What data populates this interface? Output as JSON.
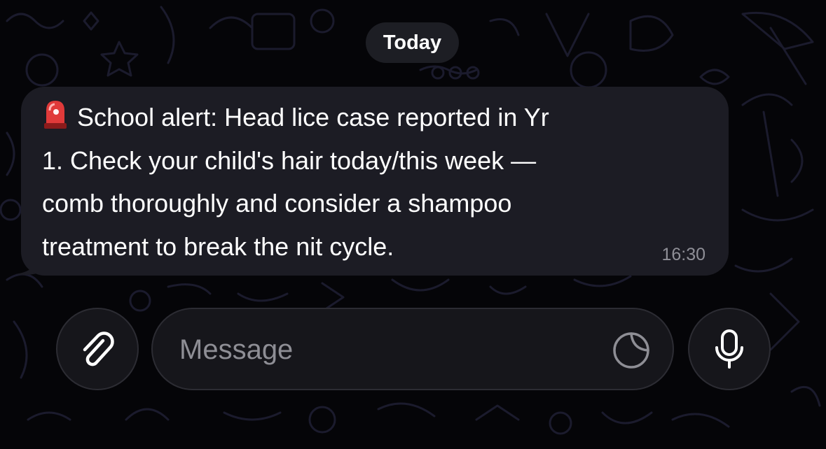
{
  "chat": {
    "date_label": "Today",
    "message": {
      "emoji": "siren-emoji",
      "text_lines": [
        "School alert: Head lice case reported in Yr",
        "1. Check your child's hair today/this week —",
        "comb thoroughly and consider a shampoo",
        "treatment to break the nit cycle."
      ],
      "time": "16:30"
    }
  },
  "composer": {
    "placeholder": "Message",
    "attach_icon": "paperclip-icon",
    "sticker_icon": "sticker-icon",
    "mic_icon": "microphone-icon"
  },
  "colors": {
    "background": "#050508",
    "bubble": "#1c1c24",
    "text": "#ffffff",
    "muted": "#8f8f97",
    "doodle": "#1a1a2e"
  }
}
